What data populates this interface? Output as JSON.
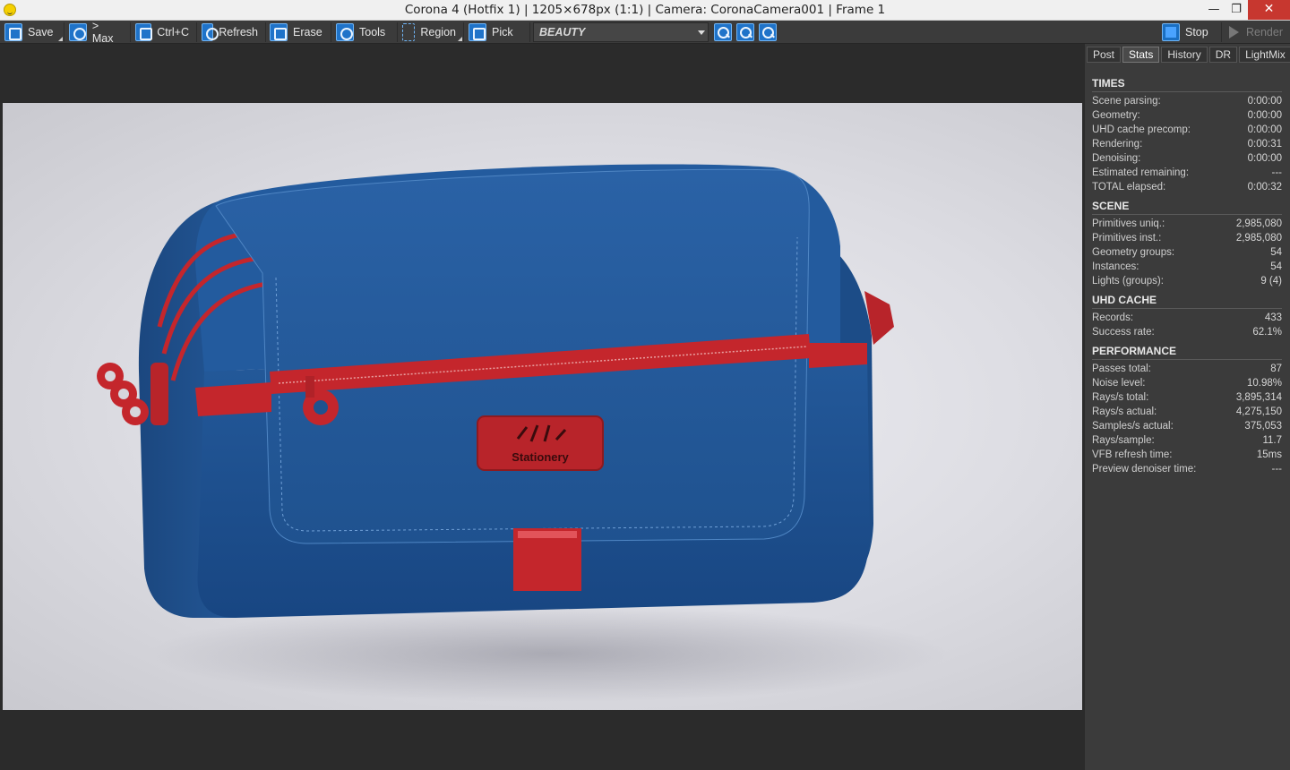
{
  "window": {
    "title": "Corona 4 (Hotfix 1) | 1205×678px (1:1) | Camera: CoronaCamera001 | Frame 1",
    "minimize": "—",
    "restore": "❐",
    "close": "✕"
  },
  "toolbar": {
    "save": "Save",
    "max": "> Max",
    "copy": "Ctrl+C",
    "refresh": "Refresh",
    "erase": "Erase",
    "tools": "Tools",
    "region": "Region",
    "pick": "Pick",
    "channel": "BEAUTY",
    "stop": "Stop",
    "render": "Render"
  },
  "panel": {
    "tabs": [
      "Post",
      "Stats",
      "History",
      "DR",
      "LightMix"
    ],
    "active_tab": "Stats",
    "sections": [
      {
        "title": "TIMES",
        "rows": [
          {
            "label": "Scene parsing:",
            "value": "0:00:00"
          },
          {
            "label": "Geometry:",
            "value": "0:00:00"
          },
          {
            "label": "UHD cache precomp:",
            "value": "0:00:00"
          },
          {
            "label": "Rendering:",
            "value": "0:00:31"
          },
          {
            "label": "Denoising:",
            "value": "0:00:00"
          },
          {
            "label": "Estimated remaining:",
            "value": "---"
          },
          {
            "label": "TOTAL elapsed:",
            "value": "0:00:32"
          }
        ]
      },
      {
        "title": "SCENE",
        "rows": [
          {
            "label": "Primitives uniq.:",
            "value": "2,985,080"
          },
          {
            "label": "Primitives inst.:",
            "value": "2,985,080"
          },
          {
            "label": "Geometry groups:",
            "value": "54"
          },
          {
            "label": "Instances:",
            "value": "54"
          },
          {
            "label": "Lights (groups):",
            "value": "9 (4)"
          }
        ]
      },
      {
        "title": "UHD CACHE",
        "rows": [
          {
            "label": "Records:",
            "value": "433"
          },
          {
            "label": "Success rate:",
            "value": "62.1%"
          }
        ]
      },
      {
        "title": "PERFORMANCE",
        "rows": [
          {
            "label": "Passes total:",
            "value": "87"
          },
          {
            "label": "Noise level:",
            "value": "10.98%"
          },
          {
            "label": "Rays/s total:",
            "value": "3,895,314"
          },
          {
            "label": "Rays/s actual:",
            "value": "4,275,150"
          },
          {
            "label": "Samples/s actual:",
            "value": "375,053"
          },
          {
            "label": "Rays/sample:",
            "value": "11.7"
          },
          {
            "label": "VFB refresh time:",
            "value": "15ms"
          },
          {
            "label": "Preview denoiser time:",
            "value": "---"
          }
        ]
      }
    ]
  },
  "render": {
    "label_text": "Stationery",
    "colors": {
      "bag": "#1e4f8c",
      "accent": "#c4262c",
      "background": "#dedee4"
    }
  }
}
